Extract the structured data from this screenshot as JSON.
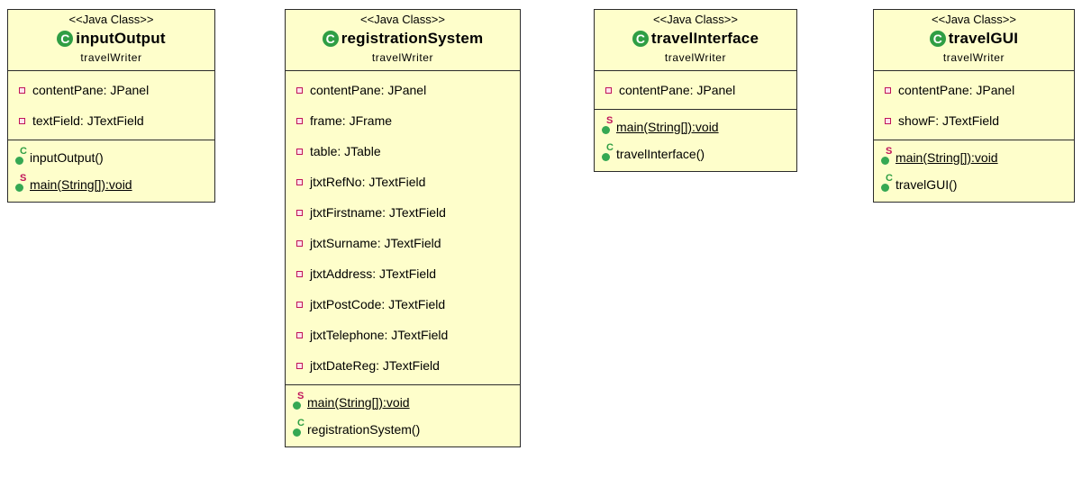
{
  "classes": [
    {
      "stereotype": "<<Java Class>>",
      "name": "inputOutput",
      "package": "travelWriter",
      "attributes": [
        "contentPane: JPanel",
        "textField: JTextField"
      ],
      "operations": [
        {
          "label": "inputOutput()",
          "kind": "constructor",
          "modifier": "C"
        },
        {
          "label": "main(String[]):void",
          "kind": "static",
          "modifier": "S"
        }
      ]
    },
    {
      "stereotype": "<<Java Class>>",
      "name": "registrationSystem",
      "package": "travelWriter",
      "attributes": [
        "contentPane: JPanel",
        "frame: JFrame",
        "table: JTable",
        "jtxtRefNo: JTextField",
        "jtxtFirstname: JTextField",
        "jtxtSurname: JTextField",
        "jtxtAddress: JTextField",
        "jtxtPostCode: JTextField",
        "jtxtTelephone: JTextField",
        "jtxtDateReg: JTextField"
      ],
      "operations": [
        {
          "label": "main(String[]):void",
          "kind": "static",
          "modifier": "S"
        },
        {
          "label": "registrationSystem()",
          "kind": "constructor",
          "modifier": "C"
        }
      ]
    },
    {
      "stereotype": "<<Java Class>>",
      "name": "travelInterface",
      "package": "travelWriter",
      "attributes": [
        "contentPane: JPanel"
      ],
      "operations": [
        {
          "label": "main(String[]):void",
          "kind": "static",
          "modifier": "S"
        },
        {
          "label": "travelInterface()",
          "kind": "constructor",
          "modifier": "C"
        }
      ]
    },
    {
      "stereotype": "<<Java Class>>",
      "name": "travelGUI",
      "package": "travelWriter",
      "attributes": [
        "contentPane: JPanel",
        "showF: JTextField"
      ],
      "operations": [
        {
          "label": "main(String[]):void",
          "kind": "static",
          "modifier": "S"
        },
        {
          "label": "travelGUI()",
          "kind": "constructor",
          "modifier": "C"
        }
      ]
    }
  ],
  "icons": {
    "class_icon_letter": "C",
    "attribute_icon": "private-field-icon",
    "operation_icon": "public-method-icon"
  },
  "colors": {
    "class_fill": "#fefecb",
    "border": "#2b2b2b",
    "class_icon": "#2f9e44",
    "private_marker": "#c0145a",
    "static_marker": "#c0145a"
  }
}
